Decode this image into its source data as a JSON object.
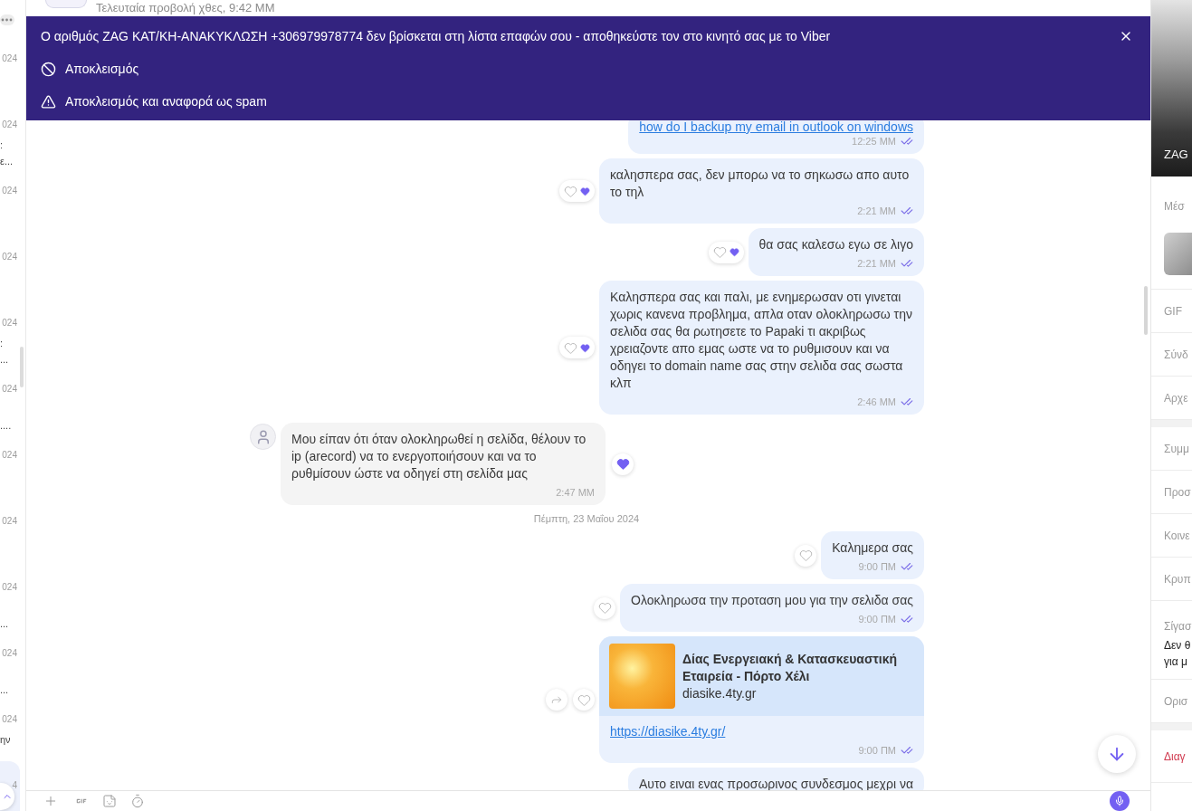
{
  "header": {
    "status": "Τελευταία προβολή χθες, 9:42 ΜΜ"
  },
  "chat_list": {
    "items": [
      {
        "date": "024",
        "selected": false
      },
      {
        "date": "024",
        "line_1": ":",
        "line_2": "ε...",
        "selected": false
      },
      {
        "date": "024",
        "selected": false
      },
      {
        "date": "024",
        "selected": false
      },
      {
        "date": "024",
        "line_1": ":",
        "line_2": "...",
        "selected": false
      },
      {
        "date": "024",
        "line_2": "....",
        "selected": false
      },
      {
        "date": "024",
        "selected": false
      },
      {
        "date": "024",
        "selected": false
      },
      {
        "date": "024",
        "line_2": "...",
        "selected": false
      },
      {
        "date": "024",
        "line_2": "...",
        "selected": false
      },
      {
        "date": "024",
        "line_1": "ην",
        "selected": false
      },
      {
        "date": "4",
        "selected": true
      }
    ]
  },
  "banner": {
    "message": "Ο αριθμός ZAG ΚΑΤ/ΚΗ-ΑΝΑΚΥΚΛΩΣΗ +306979978774 δεν βρίσκεται στη λίστα επαφών σου - αποθηκεύστε τον στο κινητό σας με το Viber",
    "actions": [
      {
        "kind": "block",
        "label": "Αποκλεισμός"
      },
      {
        "kind": "report",
        "label": "Αποκλεισμός και αναφορά ως spam"
      }
    ]
  },
  "messages": [
    {
      "kind": "outgoing",
      "link": "how do I backup my email in outlook on windows",
      "time": "12:25 ΜΜ",
      "seen": true
    },
    {
      "kind": "outgoing",
      "text": "καλησπερα σας, δεν μπορω να το σηκωσω απο αυτο το τηλ",
      "time": "2:21 ΜΜ",
      "seen": true,
      "reaction": {
        "liked": false,
        "heart_received": true
      }
    },
    {
      "kind": "outgoing",
      "text": "θα σας καλεσω εγω σε λιγο",
      "time": "2:21 ΜΜ",
      "seen": true,
      "reaction": {
        "liked": false,
        "heart_received": true
      }
    },
    {
      "kind": "outgoing",
      "text": "Καλησπερα σας και παλι, με ενημερωσαν οτι γινεται χωρις κανενα προβλημα, απλα οταν ολοκληρωσω την σελιδα σας θα ρωτησετε το Papaki τι ακριβως χρειαζοντε απο εμας ωστε να το ρυθμισουν και να οδηγει το domain name σας στην σελιδα σας σωστα κλπ",
      "time": "2:46 ΜΜ",
      "seen": true,
      "reaction": {
        "liked": false,
        "heart_received": true
      }
    },
    {
      "kind": "incoming",
      "text": "Μου είπαν ότι όταν ολοκληρωθεί η σελίδα, θέλουν το ip (arecord) να το ενεργοποιήσουν και να το ρυθμίσουν ώστε να οδηγεί στη σελίδα μας",
      "time": "2:47 ΜΜ",
      "reaction": {
        "liked": true,
        "heart_received": false
      }
    },
    {
      "kind": "date",
      "text": "Πέμπτη, 23 Μαΐου 2024"
    },
    {
      "kind": "outgoing",
      "text": "Καλημερα σας",
      "time": "9:00 ΠΜ",
      "seen": true,
      "reaction": {
        "liked": false,
        "heart_received": false
      }
    },
    {
      "kind": "outgoing",
      "text": "Ολοκληρωσα την προταση μου για την σελιδα σας",
      "time": "9:00 ΠΜ",
      "seen": true,
      "reaction": {
        "liked": false,
        "heart_received": false
      }
    },
    {
      "kind": "link_preview",
      "title": "Δίας Ενεργειακή & Κατασκευαστική Εταιρεία - Πόρτο Χέλι",
      "domain": "diasike.4ty.gr",
      "url": "https://diasike.4ty.gr/",
      "time": "9:00 ΠΜ",
      "seen": true,
      "shareable": true,
      "reaction": {
        "liked": false,
        "heart_received": false
      }
    },
    {
      "kind": "outgoing",
      "text": "Αυτο ειναι ενας προσωρινος συνδεσμος μεχρι να"
    }
  ],
  "info_panel": {
    "name": "ZAG",
    "sections": [
      {
        "rows": [
          {
            "kind": "media",
            "label": "Μέσ"
          },
          {
            "kind": "item",
            "label": "GIF"
          },
          {
            "kind": "item",
            "label": "Σύνδ"
          },
          {
            "kind": "item",
            "label": "Αρχε"
          }
        ]
      },
      {
        "rows": [
          {
            "kind": "item",
            "label": "Συμμ"
          },
          {
            "kind": "item",
            "label": "Προσ"
          },
          {
            "kind": "item",
            "label": "Κοινε"
          },
          {
            "kind": "item",
            "label": "Κρυπ"
          },
          {
            "kind": "setting",
            "label": "Σίγασ",
            "value_lines": [
              "Δεν θ",
              "για μ"
            ]
          },
          {
            "kind": "item",
            "label": "Ορισ"
          }
        ]
      },
      {
        "rows": [
          {
            "kind": "danger",
            "label": "Διαγ"
          }
        ]
      }
    ]
  }
}
